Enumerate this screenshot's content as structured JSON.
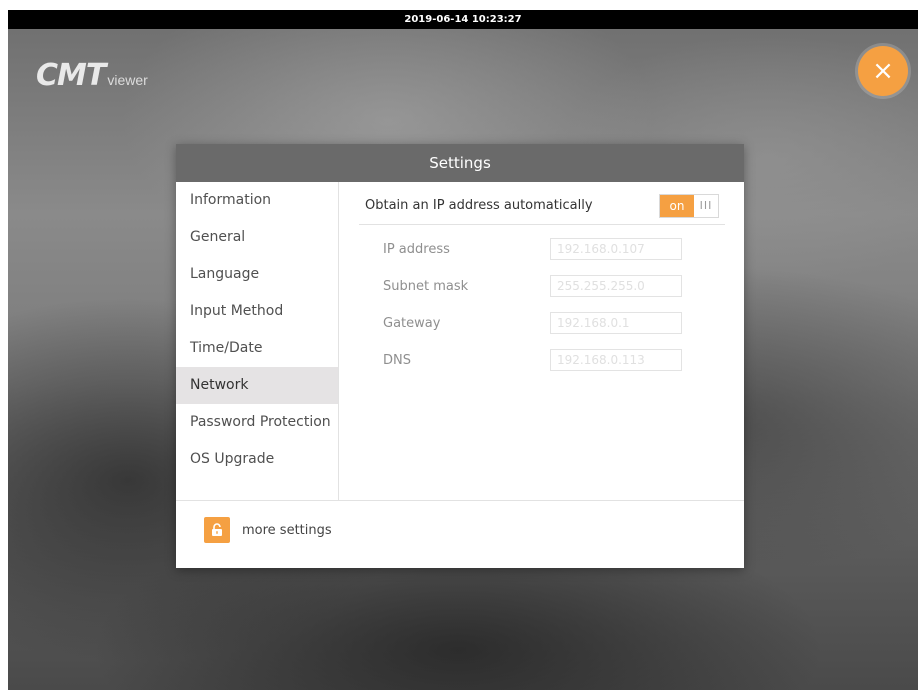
{
  "status_bar": {
    "datetime": "2019-06-14 10:23:27"
  },
  "brand": {
    "logo_main": "CMT",
    "logo_sub": "viewer"
  },
  "close_button": {
    "glyph": "×"
  },
  "dialog": {
    "title": "Settings",
    "sidebar": {
      "items": [
        {
          "label": "Information"
        },
        {
          "label": "General"
        },
        {
          "label": "Language"
        },
        {
          "label": "Input Method"
        },
        {
          "label": "Time/Date"
        },
        {
          "label": "Network"
        },
        {
          "label": "Password Protection"
        },
        {
          "label": "OS Upgrade"
        }
      ],
      "selected": "Network"
    },
    "network": {
      "dhcp_label": "Obtain an IP address automatically",
      "dhcp_toggle": {
        "on_label": "on",
        "off_label": "III",
        "state": "on"
      },
      "fields": [
        {
          "label": "IP address",
          "value": "192.168.0.107"
        },
        {
          "label": "Subnet mask",
          "value": "255.255.255.0"
        },
        {
          "label": "Gateway",
          "value": "192.168.0.1"
        },
        {
          "label": "DNS",
          "value": "192.168.0.113"
        }
      ]
    },
    "footer": {
      "more_settings_label": "more settings",
      "icon": "unlock-icon"
    }
  },
  "colors": {
    "accent": "#f5a042",
    "header_bg": "#6a6a6a",
    "selected_item_bg": "#e5e3e4"
  }
}
